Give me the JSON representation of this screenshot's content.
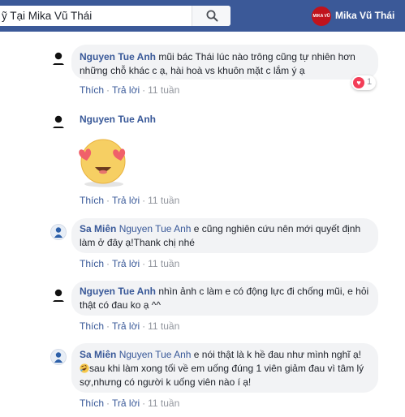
{
  "search": {
    "value": "ỹ Tại Mika Vũ Thái"
  },
  "profile": {
    "name": "Mika Vũ Thái",
    "logo_text": "MIKA VŨ THÁI"
  },
  "action_labels": {
    "like": "Thích",
    "reply": "Trả lời",
    "sep": "·"
  },
  "comments": [
    {
      "author": "Nguyen Tue Anh",
      "text": "mũi bác Thái lúc nào trông cũng tự nhiên hơn những chỗ khác c ạ, hài hoà vs khuôn mặt c lắm ý ạ",
      "time": "11 tuần",
      "reaction_count": "1",
      "reaction_icon": "heart-love"
    },
    {
      "author": "Nguyen Tue Anh",
      "sticker": "heart-eyes-emoji",
      "time": "11 tuần"
    },
    {
      "author": "Sa Miên",
      "mention": "Nguyen Tue Anh",
      "text": "e cũng nghiên cứu nên mới quyết định làm ở đây ạ!Thank chị nhé",
      "time": "11 tuần"
    },
    {
      "author": "Nguyen Tue Anh",
      "text": "nhìn ảnh c làm e có động lực đi chống mũi, e hỏi thật có đau ko ạ ^^",
      "time": "11 tuần"
    },
    {
      "author": "Sa Miên",
      "mention": "Nguyen Tue Anh",
      "text_a": "e nói thật là k hề đau như mình nghĩ ạ!",
      "emoji": "rolling-on-floor-laughing",
      "text_b": "sau khi làm xong tối về em uống đúng 1 viên giảm đau vì tâm lý sợ,nhưng có người k uống viên nào í ạ!",
      "time": "11 tuần"
    }
  ],
  "colors": {
    "topbar": "#3b5998",
    "link": "#385898",
    "bubble": "#f2f3f5",
    "heart": "#f33e58"
  }
}
